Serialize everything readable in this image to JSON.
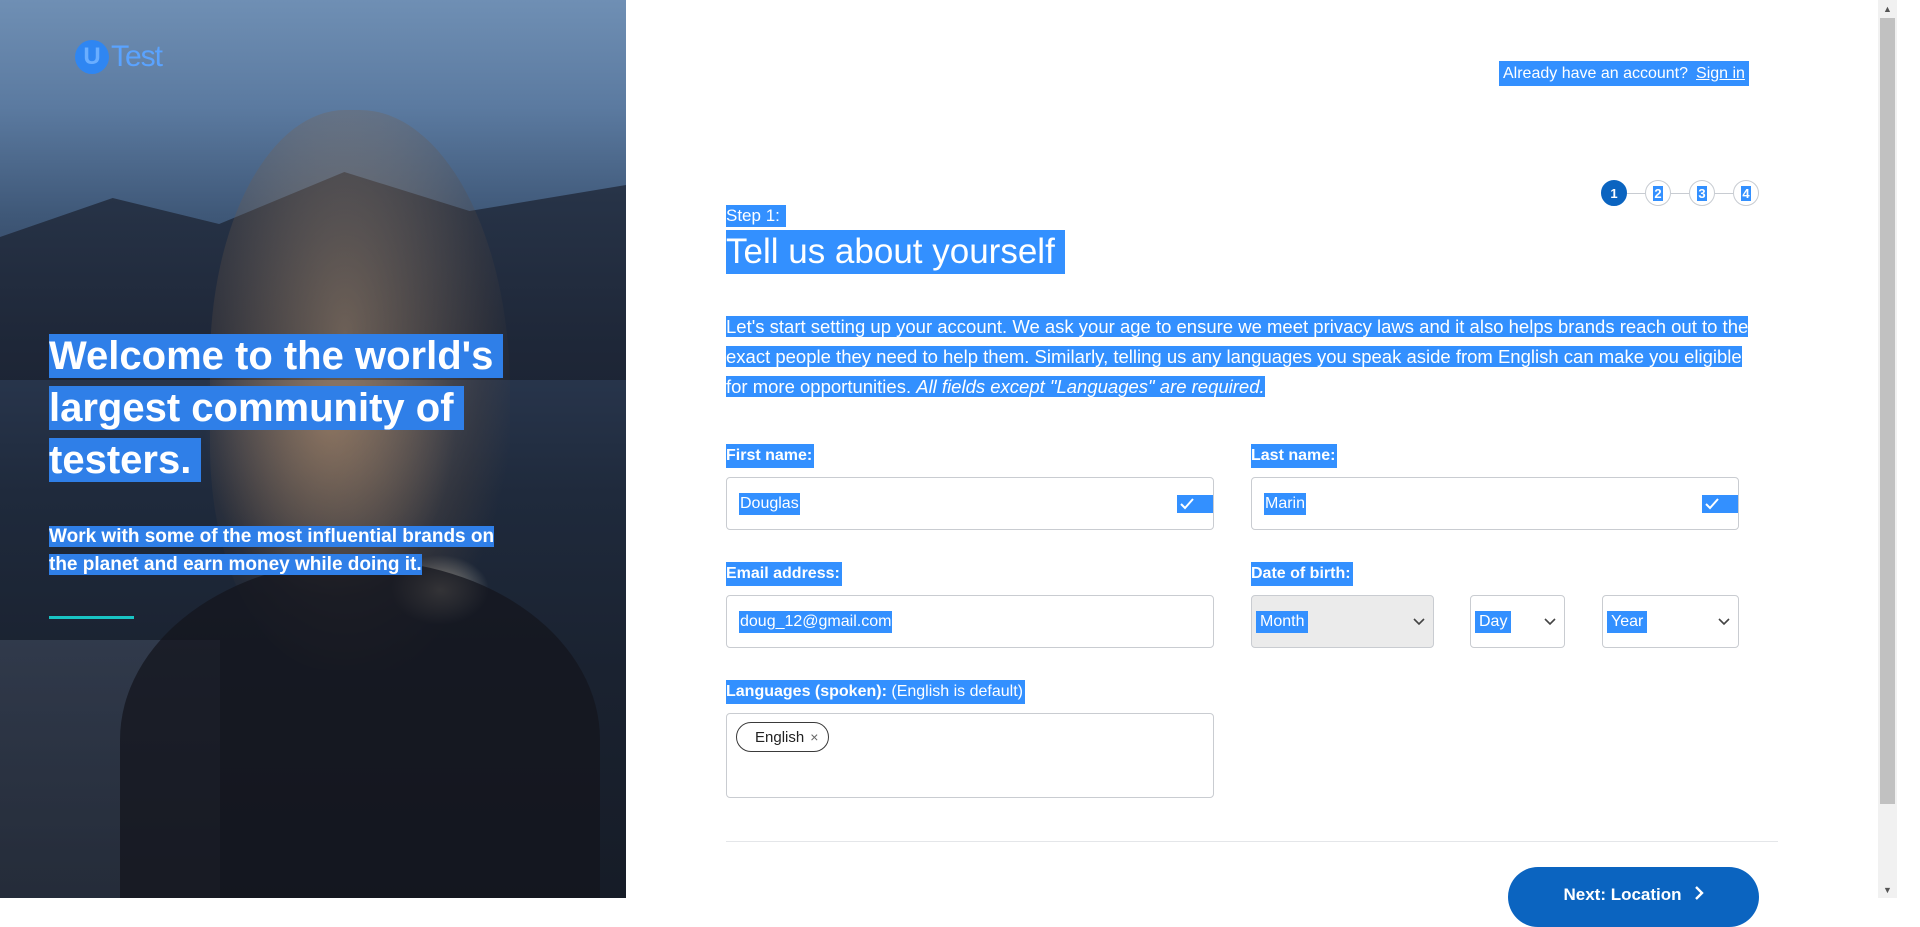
{
  "hero": {
    "logo_u": "U",
    "logo_text": "Test",
    "title_line1": "Welcome to the world's",
    "title_line2": "largest community of",
    "title_line3": "testers.",
    "subtitle_line1": "Work with some of the most influential brands on",
    "subtitle_line2": "the planet and earn money while doing it."
  },
  "header": {
    "account_prompt": "Already have an account?",
    "signin_label": "Sign in"
  },
  "stepper": {
    "steps": [
      "1",
      "2",
      "3",
      "4"
    ],
    "current_step": 1
  },
  "form": {
    "step_label": "Step 1:",
    "title": "Tell us about yourself",
    "intro_text": "Let's start setting up your account. We ask your age to ensure we meet privacy laws and it also helps brands reach out to the exact people they need to help them. Similarly, telling us any languages you speak aside from English can make you eligible for more opportunities.",
    "intro_required": "All fields except \"Languages\" are required.",
    "first_name": {
      "label": "First name:",
      "value": "Douglas"
    },
    "last_name": {
      "label": "Last name:",
      "value": "Marin"
    },
    "email": {
      "label": "Email address:",
      "value": "doug_12@gmail.com"
    },
    "dob": {
      "label": "Date of birth:",
      "month": "Month",
      "day": "Day",
      "year": "Year"
    },
    "languages": {
      "label": "Languages (spoken):",
      "hint": "(English is default)",
      "chips": [
        "English"
      ],
      "chip_remove": "×"
    },
    "next_label": "Next: Location"
  },
  "colors": {
    "selection": "#3390ff",
    "primary": "#0b64c0",
    "accent_line": "#19c4c4"
  }
}
